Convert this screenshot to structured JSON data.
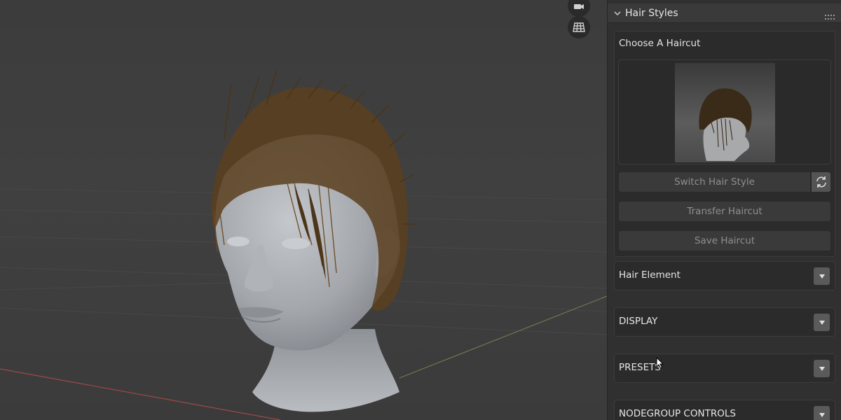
{
  "panel": {
    "title": "Hair Styles",
    "collapse_icon": "chevron-down-icon",
    "grip_icon": "drag-grip-icon"
  },
  "choose_haircut": {
    "label": "Choose A Haircut",
    "preview_icon": "haircut-preview-thumbnail",
    "switch_label": "Switch Hair Style",
    "refresh_icon": "refresh-icon",
    "transfer_label": "Transfer Haircut",
    "save_label": "Save Haircut"
  },
  "sections": [
    {
      "label": "Hair Element",
      "icon": "dropdown-arrow-icon"
    },
    {
      "label": "DISPLAY",
      "icon": "dropdown-arrow-icon"
    },
    {
      "label": "PRESETS",
      "icon": "dropdown-arrow-icon"
    },
    {
      "label": "NODEGROUP CONTROLS",
      "icon": "dropdown-arrow-icon"
    }
  ],
  "viewport": {
    "nav_icons": [
      "camera-icon",
      "grid-icon"
    ],
    "grid_x_axis_color": "#a0484a",
    "grid_y_axis_color": "#6f7a4f",
    "hair_color": "#5a3f1f",
    "skin_color": "#a9adb3"
  },
  "colors": {
    "panel_bg": "#303030",
    "box_bg": "#2b2b2b",
    "button_bg": "#3a3a3a",
    "text": "#e6e6e6",
    "disabled_text": "#8f8f8f"
  }
}
